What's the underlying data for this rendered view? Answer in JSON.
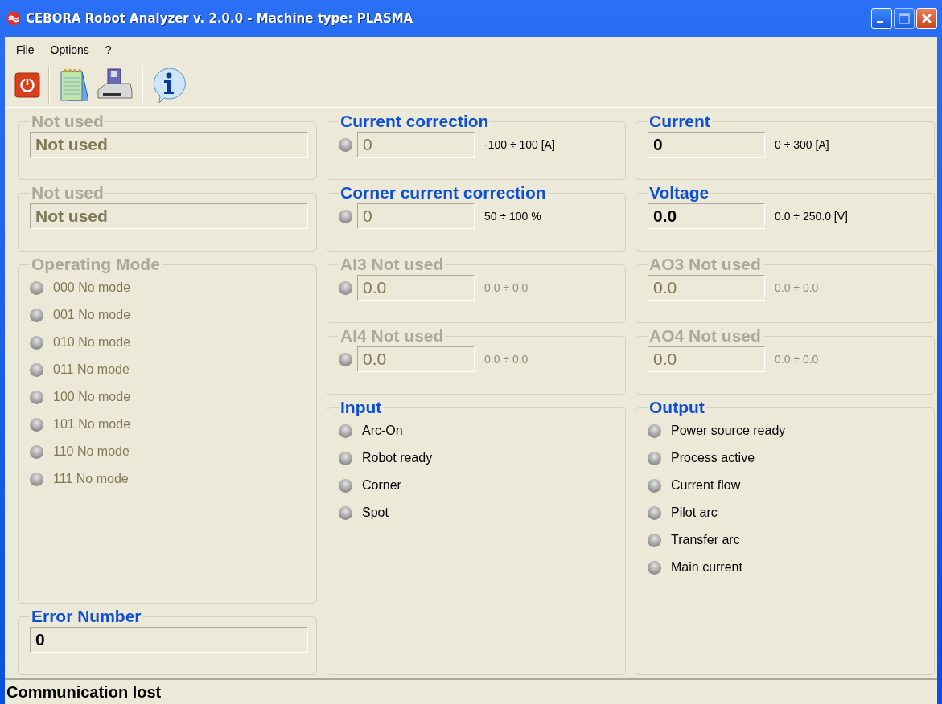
{
  "window": {
    "title": "CEBORA Robot Analyzer v. 2.0.0 - Machine type: PLASMA"
  },
  "menu": [
    "File",
    "Options",
    "?"
  ],
  "columns": [
    [
      {
        "title": "Not used",
        "disabled": true,
        "kind": "field",
        "value": "Not used",
        "value_dimmed": true
      },
      {
        "title": "Not used",
        "disabled": true,
        "kind": "field",
        "value": "Not used",
        "value_dimmed": true
      },
      {
        "title": "Operating Mode",
        "disabled": true,
        "kind": "list",
        "items": [
          {
            "label": "000 No mode",
            "on": false,
            "dimmed": true
          },
          {
            "label": "001 No mode",
            "on": false,
            "dimmed": true
          },
          {
            "label": "010 No mode",
            "on": false,
            "dimmed": true
          },
          {
            "label": "011 No mode",
            "on": false,
            "dimmed": true
          },
          {
            "label": "100 No mode",
            "on": false,
            "dimmed": true
          },
          {
            "label": "101 No mode",
            "on": false,
            "dimmed": true
          },
          {
            "label": "110 No mode",
            "on": false,
            "dimmed": true
          },
          {
            "label": "111 No mode",
            "on": false,
            "dimmed": true
          }
        ]
      },
      {
        "title": "Error Number",
        "disabled": false,
        "kind": "field",
        "value": "0",
        "value_dimmed": false
      }
    ],
    [
      {
        "title": "Current correction",
        "disabled": false,
        "kind": "led_field",
        "led_on": false,
        "value": "0",
        "value_dimmed": true,
        "range": "-100 ÷ 100 [A]",
        "range_dimmed": false
      },
      {
        "title": "Corner current correction",
        "disabled": false,
        "kind": "led_field",
        "led_on": false,
        "value": "0",
        "value_dimmed": true,
        "range": "50 ÷ 100 %",
        "range_dimmed": false
      },
      {
        "title": "AI3 Not used",
        "disabled": true,
        "kind": "led_field",
        "led_on": false,
        "value": "0.0",
        "value_dimmed": true,
        "range": "0.0 ÷ 0.0",
        "range_dimmed": true
      },
      {
        "title": "AI4 Not used",
        "disabled": true,
        "kind": "led_field",
        "led_on": false,
        "value": "0.0",
        "value_dimmed": true,
        "range": "0.0 ÷ 0.0",
        "range_dimmed": true
      },
      {
        "title": "Input",
        "disabled": false,
        "kind": "list",
        "items": [
          {
            "label": "Arc-On",
            "on": false,
            "dimmed": false
          },
          {
            "label": "Robot ready",
            "on": false,
            "dimmed": false
          },
          {
            "label": "Corner",
            "on": false,
            "dimmed": false
          },
          {
            "label": "Spot",
            "on": false,
            "dimmed": false
          }
        ]
      }
    ],
    [
      {
        "title": "Current",
        "disabled": false,
        "kind": "field",
        "value": "0",
        "value_dimmed": false,
        "range": "0 ÷ 300 [A]",
        "range_dimmed": false
      },
      {
        "title": "Voltage",
        "disabled": false,
        "kind": "field",
        "value": "0.0",
        "value_dimmed": false,
        "range": "0.0 ÷ 250.0 [V]",
        "range_dimmed": false
      },
      {
        "title": "AO3 Not used",
        "disabled": true,
        "kind": "field",
        "value": "0.0",
        "value_dimmed": true,
        "range": "0.0 ÷ 0.0",
        "range_dimmed": true
      },
      {
        "title": "AO4 Not used",
        "disabled": true,
        "kind": "field",
        "value": "0.0",
        "value_dimmed": true,
        "range": "0.0 ÷ 0.0",
        "range_dimmed": true
      },
      {
        "title": "Output",
        "disabled": false,
        "kind": "list",
        "items": [
          {
            "label": "Power source ready",
            "on": false,
            "dimmed": false
          },
          {
            "label": "Process active",
            "on": false,
            "dimmed": false
          },
          {
            "label": "Current flow",
            "on": false,
            "dimmed": false
          },
          {
            "label": "Pilot arc",
            "on": false,
            "dimmed": false
          },
          {
            "label": "Transfer arc",
            "on": false,
            "dimmed": false
          },
          {
            "label": "Main current",
            "on": false,
            "dimmed": false
          }
        ]
      }
    ]
  ],
  "status_bar": "Communication lost"
}
